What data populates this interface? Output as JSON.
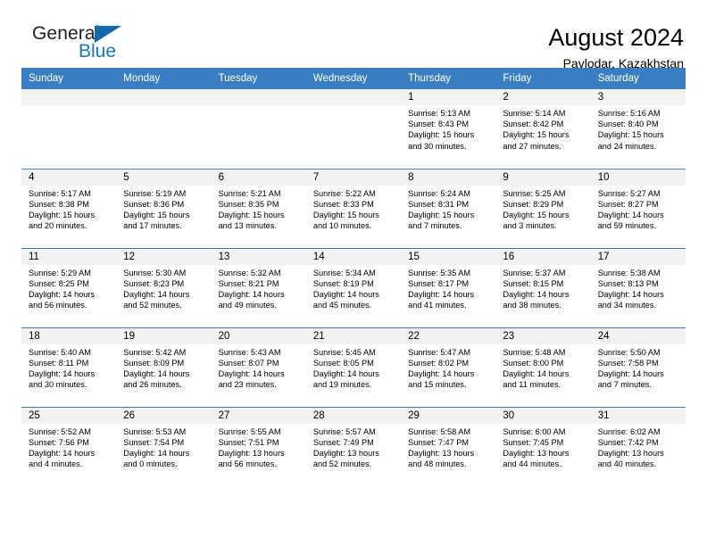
{
  "logo": {
    "word1": "General",
    "word2": "Blue",
    "triangle_color": "#1268ad",
    "blue_color": "#1b77c1"
  },
  "header": {
    "title": "August 2024",
    "subtitle": "Pavlodar, Kazakhstan"
  },
  "theme": {
    "header_blue": "#3a7dc0",
    "daynum_bg": "#f2f2f2"
  },
  "weekday_headers": [
    "Sunday",
    "Monday",
    "Tuesday",
    "Wednesday",
    "Thursday",
    "Friday",
    "Saturday"
  ],
  "weeks": [
    [
      {
        "day": "",
        "lines": []
      },
      {
        "day": "",
        "lines": []
      },
      {
        "day": "",
        "lines": []
      },
      {
        "day": "",
        "lines": []
      },
      {
        "day": "1",
        "lines": [
          "Sunrise: 5:13 AM",
          "Sunset: 8:43 PM",
          "Daylight: 15 hours",
          "and 30 minutes."
        ]
      },
      {
        "day": "2",
        "lines": [
          "Sunrise: 5:14 AM",
          "Sunset: 8:42 PM",
          "Daylight: 15 hours",
          "and 27 minutes."
        ]
      },
      {
        "day": "3",
        "lines": [
          "Sunrise: 5:16 AM",
          "Sunset: 8:40 PM",
          "Daylight: 15 hours",
          "and 24 minutes."
        ]
      }
    ],
    [
      {
        "day": "4",
        "lines": [
          "Sunrise: 5:17 AM",
          "Sunset: 8:38 PM",
          "Daylight: 15 hours",
          "and 20 minutes."
        ]
      },
      {
        "day": "5",
        "lines": [
          "Sunrise: 5:19 AM",
          "Sunset: 8:36 PM",
          "Daylight: 15 hours",
          "and 17 minutes."
        ]
      },
      {
        "day": "6",
        "lines": [
          "Sunrise: 5:21 AM",
          "Sunset: 8:35 PM",
          "Daylight: 15 hours",
          "and 13 minutes."
        ]
      },
      {
        "day": "7",
        "lines": [
          "Sunrise: 5:22 AM",
          "Sunset: 8:33 PM",
          "Daylight: 15 hours",
          "and 10 minutes."
        ]
      },
      {
        "day": "8",
        "lines": [
          "Sunrise: 5:24 AM",
          "Sunset: 8:31 PM",
          "Daylight: 15 hours",
          "and 7 minutes."
        ]
      },
      {
        "day": "9",
        "lines": [
          "Sunrise: 5:25 AM",
          "Sunset: 8:29 PM",
          "Daylight: 15 hours",
          "and 3 minutes."
        ]
      },
      {
        "day": "10",
        "lines": [
          "Sunrise: 5:27 AM",
          "Sunset: 8:27 PM",
          "Daylight: 14 hours",
          "and 59 minutes."
        ]
      }
    ],
    [
      {
        "day": "11",
        "lines": [
          "Sunrise: 5:29 AM",
          "Sunset: 8:25 PM",
          "Daylight: 14 hours",
          "and 56 minutes."
        ]
      },
      {
        "day": "12",
        "lines": [
          "Sunrise: 5:30 AM",
          "Sunset: 8:23 PM",
          "Daylight: 14 hours",
          "and 52 minutes."
        ]
      },
      {
        "day": "13",
        "lines": [
          "Sunrise: 5:32 AM",
          "Sunset: 8:21 PM",
          "Daylight: 14 hours",
          "and 49 minutes."
        ]
      },
      {
        "day": "14",
        "lines": [
          "Sunrise: 5:34 AM",
          "Sunset: 8:19 PM",
          "Daylight: 14 hours",
          "and 45 minutes."
        ]
      },
      {
        "day": "15",
        "lines": [
          "Sunrise: 5:35 AM",
          "Sunset: 8:17 PM",
          "Daylight: 14 hours",
          "and 41 minutes."
        ]
      },
      {
        "day": "16",
        "lines": [
          "Sunrise: 5:37 AM",
          "Sunset: 8:15 PM",
          "Daylight: 14 hours",
          "and 38 minutes."
        ]
      },
      {
        "day": "17",
        "lines": [
          "Sunrise: 5:38 AM",
          "Sunset: 8:13 PM",
          "Daylight: 14 hours",
          "and 34 minutes."
        ]
      }
    ],
    [
      {
        "day": "18",
        "lines": [
          "Sunrise: 5:40 AM",
          "Sunset: 8:11 PM",
          "Daylight: 14 hours",
          "and 30 minutes."
        ]
      },
      {
        "day": "19",
        "lines": [
          "Sunrise: 5:42 AM",
          "Sunset: 8:09 PM",
          "Daylight: 14 hours",
          "and 26 minutes."
        ]
      },
      {
        "day": "20",
        "lines": [
          "Sunrise: 5:43 AM",
          "Sunset: 8:07 PM",
          "Daylight: 14 hours",
          "and 23 minutes."
        ]
      },
      {
        "day": "21",
        "lines": [
          "Sunrise: 5:45 AM",
          "Sunset: 8:05 PM",
          "Daylight: 14 hours",
          "and 19 minutes."
        ]
      },
      {
        "day": "22",
        "lines": [
          "Sunrise: 5:47 AM",
          "Sunset: 8:02 PM",
          "Daylight: 14 hours",
          "and 15 minutes."
        ]
      },
      {
        "day": "23",
        "lines": [
          "Sunrise: 5:48 AM",
          "Sunset: 8:00 PM",
          "Daylight: 14 hours",
          "and 11 minutes."
        ]
      },
      {
        "day": "24",
        "lines": [
          "Sunrise: 5:50 AM",
          "Sunset: 7:58 PM",
          "Daylight: 14 hours",
          "and 7 minutes."
        ]
      }
    ],
    [
      {
        "day": "25",
        "lines": [
          "Sunrise: 5:52 AM",
          "Sunset: 7:56 PM",
          "Daylight: 14 hours",
          "and 4 minutes."
        ]
      },
      {
        "day": "26",
        "lines": [
          "Sunrise: 5:53 AM",
          "Sunset: 7:54 PM",
          "Daylight: 14 hours",
          "and 0 minutes."
        ]
      },
      {
        "day": "27",
        "lines": [
          "Sunrise: 5:55 AM",
          "Sunset: 7:51 PM",
          "Daylight: 13 hours",
          "and 56 minutes."
        ]
      },
      {
        "day": "28",
        "lines": [
          "Sunrise: 5:57 AM",
          "Sunset: 7:49 PM",
          "Daylight: 13 hours",
          "and 52 minutes."
        ]
      },
      {
        "day": "29",
        "lines": [
          "Sunrise: 5:58 AM",
          "Sunset: 7:47 PM",
          "Daylight: 13 hours",
          "and 48 minutes."
        ]
      },
      {
        "day": "30",
        "lines": [
          "Sunrise: 6:00 AM",
          "Sunset: 7:45 PM",
          "Daylight: 13 hours",
          "and 44 minutes."
        ]
      },
      {
        "day": "31",
        "lines": [
          "Sunrise: 6:02 AM",
          "Sunset: 7:42 PM",
          "Daylight: 13 hours",
          "and 40 minutes."
        ]
      }
    ]
  ]
}
